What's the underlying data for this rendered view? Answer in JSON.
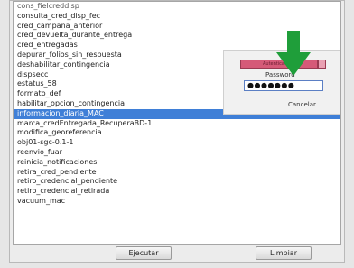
{
  "list": {
    "items": [
      "cons_fielcreddisp",
      "consulta_cred_disp_fec",
      "cred_campaña_anterior",
      "cred_devuelta_durante_entrega",
      "cred_entregadas",
      "depurar_folios_sin_respuesta",
      "deshabilitar_contingencia",
      "dispsecc",
      "estatus_58",
      "formato_def",
      "habilitar_opcion_contingencia",
      "informacion_diaria_MAC",
      "marca_credEntregada_RecuperaBD-1",
      "modifica_georeferencia",
      "obj01-sgc-0.1-1",
      "reenvio_fuar",
      "reinicia_notificaciones",
      "retira_cred_pendiente",
      "retiro_credencial_pendiente",
      "retiro_credencial_retirada",
      "vacuum_mac"
    ],
    "selected_index": 11
  },
  "buttons": {
    "execute": "Ejecutar",
    "clear": "Limpiar"
  },
  "login": {
    "title": "Autenticación",
    "password_label": "Password",
    "password_value": "●●●●●●●",
    "cancel": "Cancelar"
  },
  "colors": {
    "selection": "#3f7fd7",
    "arrow": "#1f9e3a",
    "titlebar": "#d55a78"
  },
  "icons": {
    "pointer": "down-arrow-icon"
  }
}
